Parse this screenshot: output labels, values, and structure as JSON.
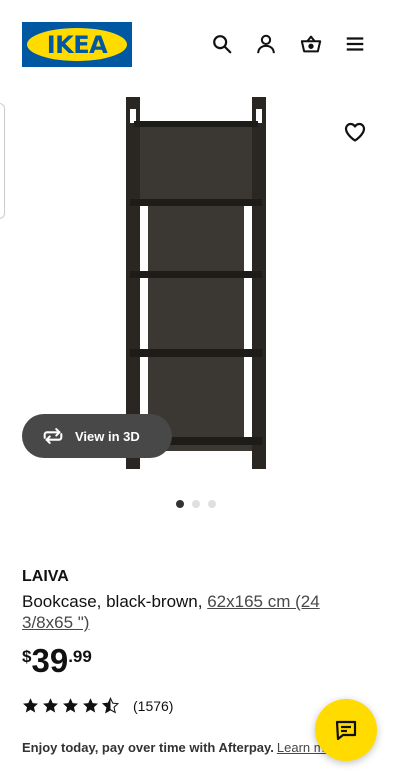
{
  "brand": {
    "logo_text": "IKEA",
    "blue": "#0058a3",
    "yellow": "#ffdb00"
  },
  "header": {
    "icons": [
      "search-icon",
      "user-icon",
      "basket-icon",
      "menu-icon"
    ]
  },
  "gallery": {
    "view3d_label": "View in 3D",
    "image_count": 3,
    "active_index": 0,
    "product_image": "bookcase-black-brown"
  },
  "product": {
    "name": "LAIVA",
    "description": "Bookcase, black-brown,",
    "size": "62x165 cm (24 3/8x65 \")",
    "price": {
      "currency": "$",
      "integer": "39",
      "decimals": ".99"
    },
    "rating": {
      "value": 4.5,
      "max": 5,
      "count": "(1576)"
    }
  },
  "afterpay": {
    "text": "Enjoy today, pay over time with Afterpay.",
    "link": "Learn more"
  },
  "chat": {
    "icon": "chat-icon"
  }
}
